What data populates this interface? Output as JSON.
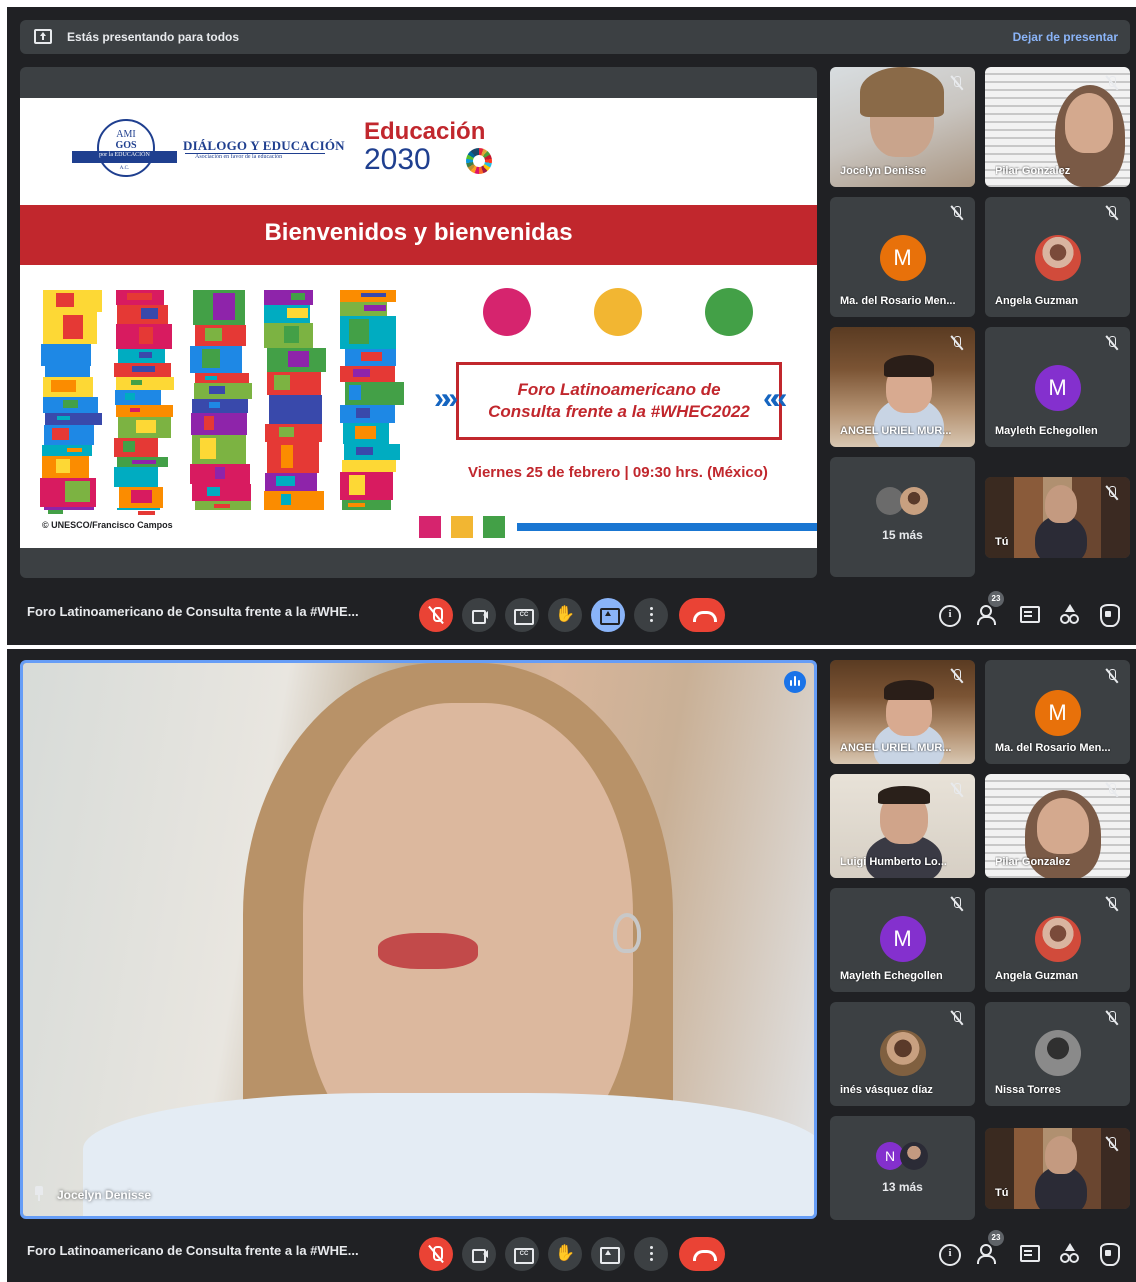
{
  "presentation_banner": {
    "text": "Estás presentando para todos",
    "stop_label": "Dejar de presentar"
  },
  "slide": {
    "amigos_logo": {
      "line1": "AMI",
      "line2": "GOS",
      "ribbon": "por la EDUCACIÓN",
      "suffix": "A.C."
    },
    "dialogo_logo": {
      "title": "DIÁLOGO Y EDUCACIÓN",
      "subtitle": "Asociación en favor de la educación"
    },
    "education_logo": {
      "line1": "Educación",
      "line2": "2030"
    },
    "title": "Bienvenidos y bienvenidas",
    "forum_line1": "Foro Latinoamericano de",
    "forum_line2": "Consulta frente a la #WHEC2022",
    "date_line": "Viernes 25 de febrero | 09:30 hrs. (México)",
    "credit": "© UNESCO/Francisco Campos",
    "chevrons_left": "»»",
    "chevrons_right": "««",
    "dot_colors": [
      "#d6246e",
      "#f2b632",
      "#43a047"
    ],
    "square_colors": [
      "#d6246e",
      "#f2b632",
      "#43a047"
    ]
  },
  "meeting1_tiles": [
    {
      "name": "Jocelyn Denisse",
      "type": "video"
    },
    {
      "name": "Pilar Gonzalez",
      "type": "video"
    },
    {
      "name": "Ma. del Rosario Men...",
      "type": "avatar",
      "initial": "M",
      "color": "#e8710a"
    },
    {
      "name": "Angela Guzman",
      "type": "photo"
    },
    {
      "name": "ANGEL URIEL MUR...",
      "type": "video"
    },
    {
      "name": "Mayleth Echegollen",
      "type": "avatar",
      "initial": "M",
      "color": "#8430ce"
    },
    {
      "more": "15 más"
    },
    {
      "name": "Tú",
      "type": "video"
    }
  ],
  "meeting2_main": {
    "name": "Jocelyn Denisse"
  },
  "meeting2_tiles": [
    {
      "name": "ANGEL URIEL MUR...",
      "type": "video"
    },
    {
      "name": "Ma. del Rosario Men...",
      "type": "avatar",
      "initial": "M",
      "color": "#e8710a"
    },
    {
      "name": "Luigi Humberto Lo...",
      "type": "video"
    },
    {
      "name": "Pilar Gonzalez",
      "type": "video"
    },
    {
      "name": "Mayleth Echegollen",
      "type": "avatar",
      "initial": "M",
      "color": "#8430ce"
    },
    {
      "name": "Angela Guzman",
      "type": "photo"
    },
    {
      "name": "inés vásquez díaz",
      "type": "photo"
    },
    {
      "name": "Nissa Torres",
      "type": "photo"
    },
    {
      "more": "13 más",
      "initial": "N"
    },
    {
      "name": "Tú",
      "type": "video"
    }
  ],
  "controls": {
    "meeting_title": "Foro Latinoamericano de Consulta frente a la #WHE...",
    "participants_count": "23",
    "buttons": [
      "mic-off",
      "camera",
      "captions",
      "raise-hand",
      "present",
      "more-options",
      "leave-call"
    ],
    "right_buttons": [
      "meeting-details",
      "participants",
      "chat",
      "activities",
      "host-controls"
    ]
  },
  "colors": {
    "background": "#202124",
    "tile": "#3c4043",
    "accent_blue": "#8ab4f8",
    "danger_red": "#ea4335",
    "slide_red": "#c1272d"
  }
}
